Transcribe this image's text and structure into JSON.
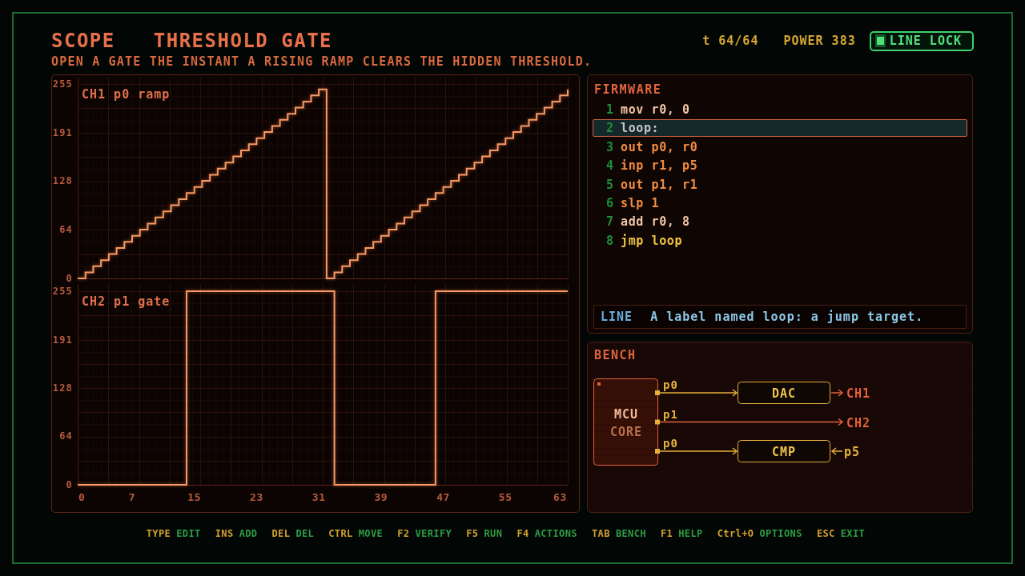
{
  "header": {
    "mode": "SCOPE",
    "title": "THRESHOLD GATE",
    "subtitle": "OPEN A GATE THE INSTANT A RISING RAMP CLEARS THE HIDDEN THRESHOLD.",
    "tick": "t 64/64",
    "power": "POWER 383",
    "line_lock": {
      "label": "LINE LOCK",
      "on": true
    }
  },
  "scope": {
    "channels": [
      {
        "chart_data": {
          "type": "line",
          "title": "CH1 p0 ramp",
          "x": [
            0,
            1,
            1,
            2,
            2,
            3,
            3,
            4,
            4,
            5,
            5,
            6,
            6,
            7,
            7,
            8,
            8,
            9,
            9,
            10,
            10,
            11,
            11,
            12,
            12,
            13,
            13,
            14,
            14,
            15,
            15,
            16,
            16,
            17,
            17,
            18,
            18,
            19,
            19,
            20,
            20,
            21,
            21,
            22,
            22,
            23,
            23,
            24,
            24,
            25,
            25,
            26,
            26,
            27,
            27,
            28,
            28,
            29,
            29,
            30,
            30,
            31,
            31,
            32,
            32,
            33,
            33,
            34,
            34,
            35,
            35,
            36,
            36,
            37,
            37,
            38,
            38,
            39,
            39,
            40,
            40,
            41,
            41,
            42,
            42,
            43,
            43,
            44,
            44,
            45,
            45,
            46,
            46,
            47,
            47,
            48,
            48,
            49,
            49,
            50,
            50,
            51,
            51,
            52,
            52,
            53,
            53,
            54,
            54,
            55,
            55,
            56,
            56,
            57,
            57,
            58,
            58,
            59,
            59,
            60,
            60,
            61,
            61,
            62,
            62,
            63,
            63
          ],
          "values": [
            0,
            0,
            8,
            8,
            16,
            16,
            24,
            24,
            32,
            32,
            40,
            40,
            48,
            48,
            56,
            56,
            64,
            64,
            72,
            72,
            80,
            80,
            88,
            88,
            96,
            96,
            104,
            104,
            112,
            112,
            120,
            120,
            128,
            128,
            136,
            136,
            144,
            144,
            152,
            152,
            160,
            160,
            168,
            168,
            176,
            176,
            184,
            184,
            192,
            192,
            200,
            200,
            208,
            208,
            216,
            216,
            224,
            224,
            232,
            232,
            240,
            240,
            248,
            248,
            0,
            0,
            8,
            8,
            16,
            16,
            24,
            24,
            32,
            32,
            40,
            40,
            48,
            48,
            56,
            56,
            64,
            64,
            72,
            72,
            80,
            80,
            88,
            88,
            96,
            96,
            104,
            104,
            112,
            112,
            120,
            120,
            128,
            128,
            136,
            136,
            144,
            144,
            152,
            152,
            160,
            160,
            168,
            168,
            176,
            176,
            184,
            184,
            192,
            192,
            200,
            200,
            208,
            208,
            216,
            216,
            224,
            224,
            232,
            232,
            240,
            240,
            248
          ],
          "xlim": [
            0,
            63
          ],
          "ylim": [
            0,
            255
          ],
          "yticks": [
            0,
            64,
            128,
            191,
            255
          ],
          "grid": true
        }
      },
      {
        "chart_data": {
          "type": "line",
          "title": "CH2 p1 gate",
          "x": [
            0,
            14,
            14,
            33,
            33,
            46,
            46,
            63
          ],
          "values": [
            0,
            0,
            255,
            255,
            0,
            0,
            255,
            255
          ],
          "xlim": [
            0,
            63
          ],
          "ylim": [
            0,
            255
          ],
          "xticks": [
            0,
            7,
            15,
            23,
            31,
            39,
            47,
            55,
            63
          ],
          "yticks": [
            0,
            64,
            128,
            191,
            255
          ],
          "grid": true
        }
      }
    ]
  },
  "firmware": {
    "title": "FIRMWARE",
    "lines": [
      {
        "number": "1",
        "code": "mov r0, 0",
        "kind": "data",
        "selected": false
      },
      {
        "number": "2",
        "code": "loop:",
        "kind": "label",
        "selected": true
      },
      {
        "number": "3",
        "code": "out p0, r0",
        "kind": "io",
        "selected": false
      },
      {
        "number": "4",
        "code": "inp r1, p5",
        "kind": "io",
        "selected": false
      },
      {
        "number": "5",
        "code": "out p1, r1",
        "kind": "io",
        "selected": false
      },
      {
        "number": "6",
        "code": "slp 1",
        "kind": "io",
        "selected": false
      },
      {
        "number": "7",
        "code": "add r0, 8",
        "kind": "data",
        "selected": false
      },
      {
        "number": "8",
        "code": "jmp loop",
        "kind": "flow",
        "selected": false
      }
    ],
    "hint": {
      "tag": "LINE",
      "text": "A label named loop: a jump target."
    }
  },
  "bench": {
    "title": "BENCH",
    "core": {
      "name": "MCU",
      "label": "CORE"
    },
    "routes": [
      {
        "port": "p0",
        "kind": "output_block",
        "block": "DAC",
        "end": "CH1"
      },
      {
        "port": "p1",
        "kind": "direct",
        "end": "CH2"
      },
      {
        "port": "p0",
        "kind": "input_block",
        "block": "CMP",
        "end": "p5"
      }
    ]
  },
  "shortcuts": [
    {
      "key": "TYPE",
      "action": "EDIT"
    },
    {
      "key": "INS",
      "action": "ADD"
    },
    {
      "key": "DEL",
      "action": "DEL"
    },
    {
      "key": "CTRL",
      "action": "MOVE"
    },
    {
      "key": "F2",
      "action": "VERIFY"
    },
    {
      "key": "F5",
      "action": "RUN"
    },
    {
      "key": "F4",
      "action": "ACTIONS"
    },
    {
      "key": "TAB",
      "action": "BENCH"
    },
    {
      "key": "F1",
      "action": "HELP"
    },
    {
      "key": "Ctrl+O",
      "action": "OPTIONS"
    },
    {
      "key": "ESC",
      "action": "EXIT"
    }
  ]
}
